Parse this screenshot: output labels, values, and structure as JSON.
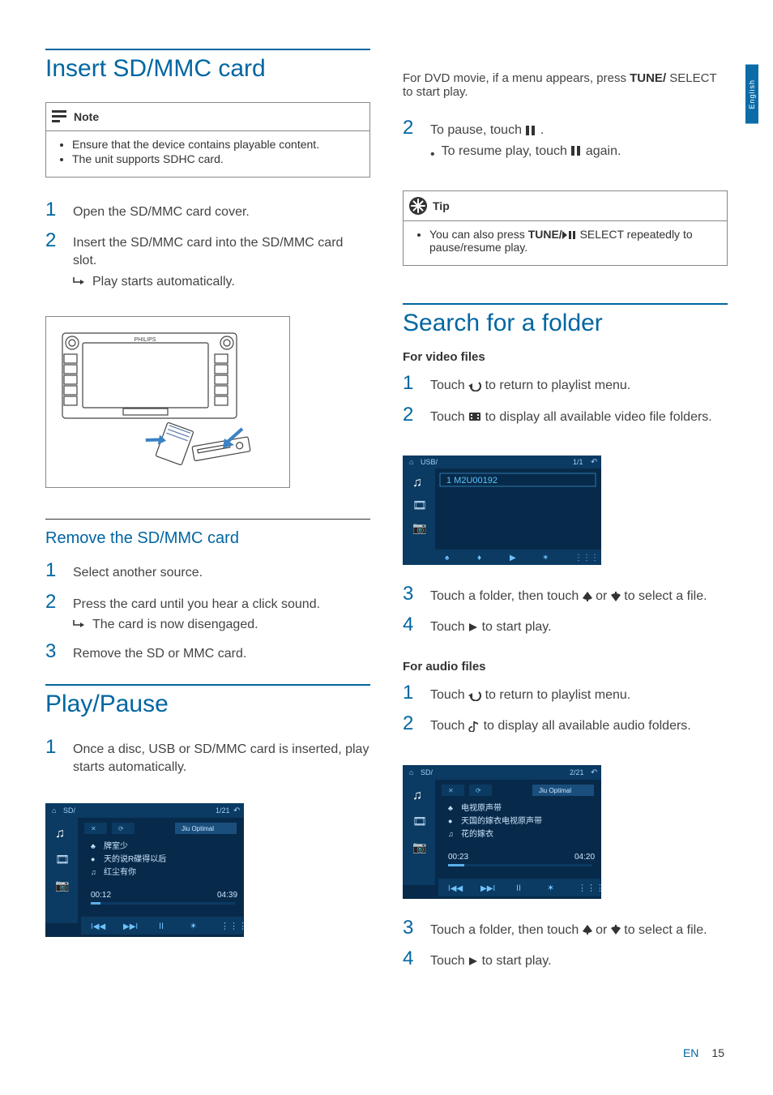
{
  "side_tab": "English",
  "left": {
    "h1_insert": "Insert SD/MMC card",
    "note": {
      "label": "Note",
      "items": [
        "Ensure that the device contains playable content.",
        "The unit supports SDHC card."
      ]
    },
    "insert_steps": [
      {
        "n": "1",
        "text": "Open the SD/MMC card cover."
      },
      {
        "n": "2",
        "text": "Insert the SD/MMC card into the SD/MMC card slot.",
        "sub_arrow": "Play starts automatically."
      }
    ],
    "h2_remove": "Remove the SD/MMC card",
    "remove_steps": [
      {
        "n": "1",
        "text": "Select another source."
      },
      {
        "n": "2",
        "text": "Press the card until you hear a click sound.",
        "sub_arrow": "The card is now disengaged."
      },
      {
        "n": "3",
        "text": "Remove the SD or MMC card."
      }
    ],
    "h1_play": "Play/Pause",
    "play_steps": [
      {
        "n": "1",
        "text": "Once a disc, USB or SD/MMC card is inserted, play starts automatically."
      }
    ],
    "player_sd": {
      "src_label": "SD/",
      "page": "1/21",
      "tab": "Jiu Optimal",
      "tracks": [
        "牌室少",
        "天的说R碟得以后",
        "红尘有你"
      ],
      "t_cur": "00:12",
      "t_tot": "04:39"
    }
  },
  "right": {
    "dvd_text": "For DVD movie, if a menu appears, press TUNE/ SELECT to start play.",
    "dvd_bold": "TUNE/",
    "pause_step": {
      "n": "2",
      "text_a": "To pause, touch ",
      "text_b": " .",
      "sub_bullet_a": "To resume play, touch ",
      "sub_bullet_b": " again."
    },
    "tip": {
      "label": "Tip",
      "text_a": "You can also press ",
      "bold": "TUNE/",
      "text_b": " SELECT repeatedly to pause/resume play."
    },
    "h1_search": "Search for a folder",
    "video_label": "For video files",
    "video_steps_a": [
      {
        "n": "1",
        "text_a": "Touch ",
        "icon": "return",
        "text_b": " to return to playlist menu."
      },
      {
        "n": "2",
        "text_a": "Touch ",
        "icon": "film",
        "text_b": " to display all available video file folders."
      }
    ],
    "folder_usb": {
      "src_label": "USB/",
      "page": "1/1",
      "item": "1  M2U00192"
    },
    "video_steps_b": [
      {
        "n": "3",
        "text_a": "Touch a folder, then touch ",
        "text_b": " or ",
        "text_c": " to select a file."
      },
      {
        "n": "4",
        "text_a": "Touch ",
        "icon": "play",
        "text_b": " to start play."
      }
    ],
    "audio_label": "For audio files",
    "audio_steps_a": [
      {
        "n": "1",
        "text_a": "Touch ",
        "icon": "return",
        "text_b": " to return to playlist menu."
      },
      {
        "n": "2",
        "text_a": "Touch ",
        "icon": "note",
        "text_b": " to display all available audio folders."
      }
    ],
    "player_sd2": {
      "src_label": "SD/",
      "page": "2/21",
      "tab": "Jiu Optimal",
      "tracks": [
        "电视原声带",
        "天国的嫁衣电视原声带",
        "花的嫁衣"
      ],
      "t_cur": "00:23",
      "t_tot": "04:20"
    },
    "audio_steps_b": [
      {
        "n": "3",
        "text_a": "Touch a folder, then touch ",
        "text_b": " or ",
        "text_c": " to select a file."
      },
      {
        "n": "4",
        "text_a": "Touch ",
        "icon": "play",
        "text_b": " to start play."
      }
    ]
  },
  "footer": {
    "lang": "EN",
    "page": "15"
  }
}
